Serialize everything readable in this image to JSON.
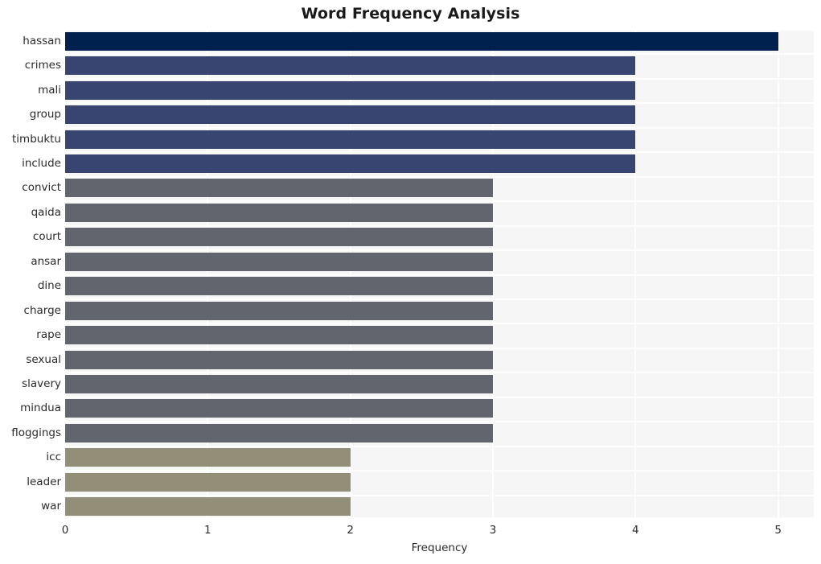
{
  "chart_data": {
    "type": "bar",
    "orientation": "horizontal",
    "title": "Word Frequency Analysis",
    "xlabel": "Frequency",
    "ylabel": "",
    "categories": [
      "hassan",
      "crimes",
      "mali",
      "group",
      "timbuktu",
      "include",
      "convict",
      "qaida",
      "court",
      "ansar",
      "dine",
      "charge",
      "rape",
      "sexual",
      "slavery",
      "mindua",
      "floggings",
      "icc",
      "leader",
      "war"
    ],
    "values": [
      5,
      4,
      4,
      4,
      4,
      4,
      3,
      3,
      3,
      3,
      3,
      3,
      3,
      3,
      3,
      3,
      3,
      2,
      2,
      2
    ],
    "bar_colors": [
      "#00204d",
      "#374570",
      "#374570",
      "#374570",
      "#374570",
      "#374570",
      "#62656d",
      "#62656d",
      "#62656d",
      "#62656d",
      "#62656d",
      "#62656d",
      "#62656d",
      "#62656d",
      "#62656d",
      "#62656d",
      "#62656d",
      "#938e77",
      "#938e77",
      "#938e77"
    ],
    "xticks": [
      0,
      1,
      2,
      3,
      4,
      5
    ],
    "xtick_labels": [
      "0",
      "1",
      "2",
      "3",
      "4",
      "5"
    ],
    "xlim": [
      0,
      5.25
    ],
    "grid": true,
    "legend": "none",
    "plot_background": "#f6f6f7",
    "figure_background": "#ffffff",
    "gridline_color": "#ffffff",
    "text_color": "#2b2b2b"
  }
}
